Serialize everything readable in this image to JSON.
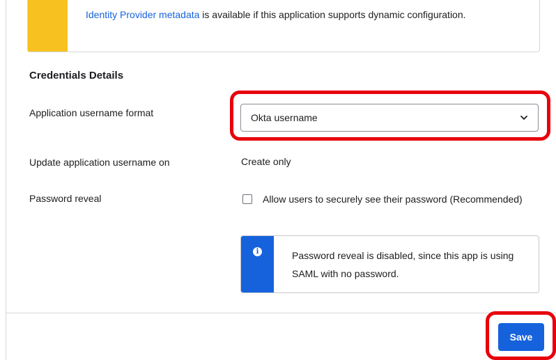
{
  "notice": {
    "link_text": "Identity Provider metadata",
    "text": " is available if this application supports dynamic configuration."
  },
  "credentials": {
    "section_title": "Credentials Details",
    "username_format_label": "Application username format",
    "username_format_value": "Okta username",
    "update_on_label": "Update application username on",
    "update_on_value": "Create only",
    "password_reveal_label": "Password reveal",
    "password_reveal_checkbox_label": "Allow users to securely see their password (Recommended)",
    "password_reveal_checked": false,
    "info_message": "Password reveal is disabled, since this app is using SAML with no password."
  },
  "footer": {
    "save_label": "Save"
  },
  "colors": {
    "accent": "#1662dd",
    "notice_bar": "#f7c11f",
    "highlight": "#e8000b"
  },
  "icons": {
    "dropdown": "chevron-down-icon",
    "info": "info-icon"
  }
}
